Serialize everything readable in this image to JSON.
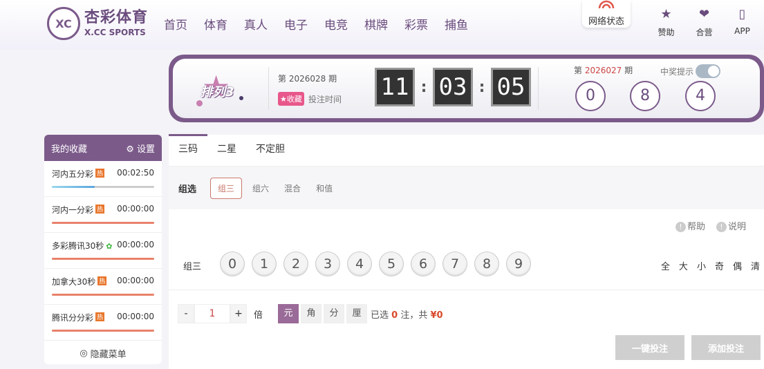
{
  "brand": {
    "name_cn": "杏彩体育",
    "name_en": "X.CC SPORTS",
    "emblem": "XC"
  },
  "nav": [
    "首页",
    "体育",
    "真人",
    "电子",
    "电竞",
    "棋牌",
    "彩票",
    "捕鱼"
  ],
  "network_status": "网络状态",
  "top_links": [
    {
      "label": "赞助",
      "icon": "bookmark-icon"
    },
    {
      "label": "合营",
      "icon": "handshake-icon"
    },
    {
      "label": "APP",
      "icon": "phone-icon"
    }
  ],
  "lottery": {
    "logo_text": "排列3",
    "current_period_prefix": "第",
    "current_period": "2026028",
    "current_period_suffix": "期",
    "favorite_label": "收藏",
    "bet_time_label": "投注时间",
    "countdown": {
      "hh": "11",
      "mm": "03",
      "ss": "05"
    },
    "prev_period_prefix": "第",
    "prev_period": "2026027",
    "prev_period_suffix": "期",
    "win_tip_label": "中奖提示",
    "win_tip_on": true,
    "result_balls": [
      "0",
      "8",
      "4"
    ]
  },
  "sidebar": {
    "title": "我的收藏",
    "settings_label": "设置",
    "items": [
      {
        "name": "河内五分彩",
        "badge": "热",
        "time": "00:02:50",
        "progress": 0.42
      },
      {
        "name": "河内一分彩",
        "badge": "热",
        "time": "00:00:00",
        "progress": 1
      },
      {
        "name": "多彩腾讯30秒",
        "badge": "gear",
        "time": "00:00:00",
        "progress": 1
      },
      {
        "name": "加拿大30秒",
        "badge": "热",
        "time": "00:00:00",
        "progress": 1
      },
      {
        "name": "腾讯分分彩",
        "badge": "热",
        "time": "00:00:00",
        "progress": 1
      }
    ],
    "hide_menu_label": "隐藏菜单"
  },
  "tabs": [
    "三码",
    "二星",
    "不定胆"
  ],
  "subtabs": {
    "group_label": "组选",
    "items": [
      "组三",
      "组六",
      "混合",
      "和值"
    ],
    "active": 0
  },
  "help": {
    "help_label": "帮助",
    "info_label": "说明"
  },
  "pick": {
    "row_label": "组三",
    "numbers": [
      "0",
      "1",
      "2",
      "3",
      "4",
      "5",
      "6",
      "7",
      "8",
      "9"
    ],
    "quick": [
      "全",
      "大",
      "小",
      "奇",
      "偶",
      "清"
    ]
  },
  "multiplier": {
    "minus": "-",
    "value": "1",
    "plus": "+",
    "label": "倍"
  },
  "units": [
    "元",
    "角",
    "分",
    "厘"
  ],
  "selection": {
    "prefix": "已选",
    "count": "0",
    "mid": "注，共",
    "amount": "¥0"
  },
  "buttons": {
    "quick_bet": "一键投注",
    "add_bet": "添加投注"
  }
}
